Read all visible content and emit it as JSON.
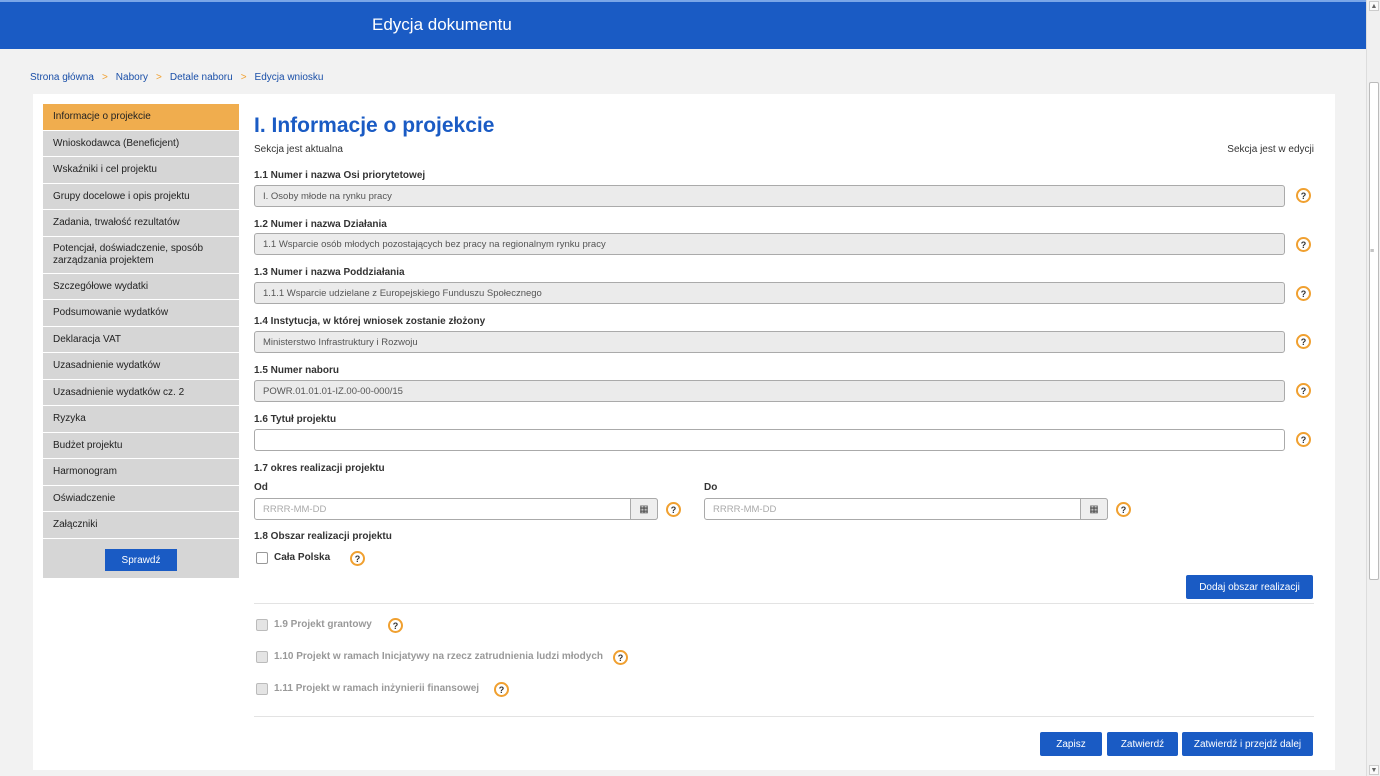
{
  "header": {
    "title": "Edycja dokumentu"
  },
  "breadcrumb": {
    "items": [
      "Strona główna",
      "Nabory",
      "Detale naboru"
    ],
    "current": "Edycja wniosku",
    "separator": ">"
  },
  "sidebar": {
    "items": [
      "Informacje o projekcie",
      "Wnioskodawca (Beneficjent)",
      "Wskaźniki i cel projektu",
      "Grupy docelowe i opis projektu",
      "Zadania, trwałość rezultatów",
      "Potencjał, doświadczenie, sposób zarządzania projektem",
      "Szczegółowe wydatki",
      "Podsumowanie wydatków",
      "Deklaracja VAT",
      "Uzasadnienie wydatków",
      "Uzasadnienie wydatków cz. 2",
      "Ryzyka",
      "Budżet projektu",
      "Harmonogram",
      "Oświadczenie",
      "Załączniki"
    ],
    "check_label": "Sprawdź"
  },
  "section": {
    "title": "I. Informacje o projekcie",
    "status_left": "Sekcja jest aktualna",
    "status_right": "Sekcja jest w edycji"
  },
  "fields": {
    "f11": {
      "label": "1.1 Numer i nazwa Osi priorytetowej",
      "value": "I. Osoby młode na rynku pracy"
    },
    "f12": {
      "label": "1.2 Numer i nazwa Działania",
      "value": "1.1 Wsparcie osób młodych pozostających bez pracy na regionalnym rynku pracy"
    },
    "f13": {
      "label": "1.3 Numer i nazwa Poddziałania",
      "value": "1.1.1  Wsparcie udzielane z Europejskiego Funduszu Społecznego"
    },
    "f14": {
      "label": "1.4 Instytucja, w której wniosek zostanie złożony",
      "value": "Ministerstwo Infrastruktury i Rozwoju"
    },
    "f15": {
      "label": "1.5 Numer naboru",
      "value": "POWR.01.01.01-IZ.00-00-000/15"
    },
    "f16": {
      "label": "1.6 Tytuł projektu",
      "value": ""
    },
    "f17": {
      "label": "1.7 okres realizacji projektu",
      "from_label": "Od",
      "to_label": "Do",
      "placeholder": "RRRR-MM-DD"
    },
    "f18": {
      "label": "1.8 Obszar realizacji projektu",
      "checkbox_label": "Cała Polska",
      "add_button": "Dodaj obszar realizacji"
    },
    "f19": {
      "label": "1.9 Projekt grantowy"
    },
    "f110": {
      "label": "1.10 Projekt w ramach Inicjatywy na rzecz zatrudnienia ludzi młodych"
    },
    "f111": {
      "label": "1.11 Projekt w ramach inżynierii finansowej"
    }
  },
  "help_glyph": "?",
  "calendar_icon": "calendar-icon",
  "footer": {
    "save": "Zapisz",
    "approve": "Zatwierdź",
    "approve_next": "Zatwierdź i przejdź dalej"
  },
  "colors": {
    "brand": "#1a5bc4",
    "active": "#f0ad4e",
    "help_ring": "#f0a030"
  }
}
